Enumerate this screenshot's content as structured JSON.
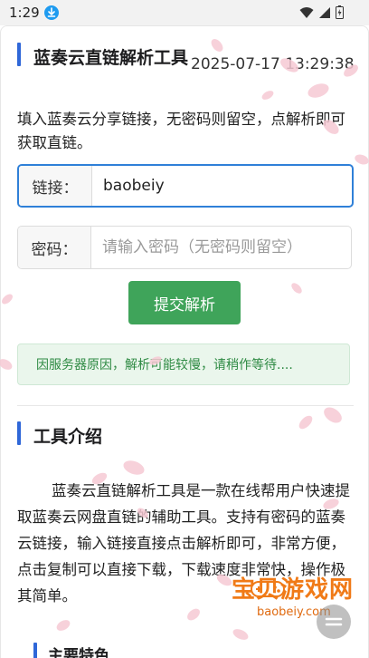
{
  "status_bar": {
    "time": "1:29"
  },
  "header": {
    "title": "蓝奏云直链解析工具",
    "datetime": "2025-07-17 13:29:38"
  },
  "intro": "填入蓝奏云分享链接，无密码则留空，点解析即可获取直链。",
  "link_field": {
    "label": "链接：",
    "value": "baobeiy"
  },
  "password_field": {
    "label": "密码：",
    "placeholder": "请输入密码（无密码则留空）"
  },
  "submit_label": "提交解析",
  "notice": "因服务器原因，解析可能较慢，请稍作等待....",
  "tool_section": {
    "title": "工具介绍",
    "description": "蓝奏云直链解析工具是一款在线帮用户快速提取蓝奏云网盘直链的辅助工具。支持有密码的蓝奏云链接，输入链接直接点击解析即可，非常方便，点击复制可以直接下载，下载速度非常快，操作极其简单。"
  },
  "features_title": "主要特色",
  "watermark": {
    "text": "宝贝游戏网",
    "sub": "baobeiy.com"
  },
  "colors": {
    "accent": "#2f67d8",
    "button": "#3fa45a",
    "notice_text": "#2e8a43",
    "petal": "#f6c9d4"
  }
}
